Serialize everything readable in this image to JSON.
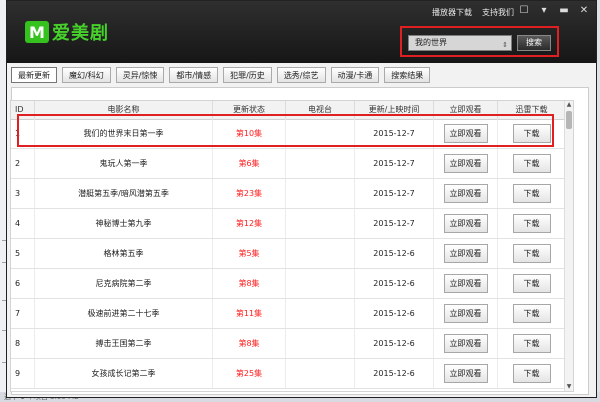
{
  "app": {
    "logo_mark": "M",
    "logo_text": "爱美剧"
  },
  "top": {
    "links": [
      "播放器下载",
      "支持我们"
    ]
  },
  "window_icons": {
    "message": "☐",
    "menu": "▾",
    "minimize": "▬",
    "close": "✕"
  },
  "search": {
    "value": "我的世界",
    "scroll_glyph": "⇕",
    "button_label": "搜索"
  },
  "tabs": [
    "最新更新",
    "魔幻/科幻",
    "灵异/惊悚",
    "都市/情感",
    "犯罪/历史",
    "选秀/综艺",
    "动漫/卡通",
    "搜索结果"
  ],
  "active_tab": "最新更新",
  "table": {
    "headers": [
      "ID",
      "电影名称",
      "更新状态",
      "电视台",
      "更新/上映时间",
      "立即观看",
      "迅雷下载"
    ],
    "rows": [
      {
        "id": "1",
        "name": "我们的世界末日第一季",
        "status": "第10集",
        "tv": "",
        "date": "2015-12-7",
        "watch": "立即观看",
        "download": "下载"
      },
      {
        "id": "2",
        "name": "鬼玩人第一季",
        "status": "第6集",
        "tv": "",
        "date": "2015-12-7",
        "watch": "立即观看",
        "download": "下载"
      },
      {
        "id": "3",
        "name": "潜艇第五季/暗风潜第五季",
        "status": "第23集",
        "tv": "",
        "date": "2015-12-7",
        "watch": "立即观看",
        "download": "下载"
      },
      {
        "id": "4",
        "name": "神秘博士第九季",
        "status": "第12集",
        "tv": "",
        "date": "2015-12-7",
        "watch": "立即观看",
        "download": "下载"
      },
      {
        "id": "5",
        "name": "格林第五季",
        "status": "第5集",
        "tv": "",
        "date": "2015-12-6",
        "watch": "立即观看",
        "download": "下载"
      },
      {
        "id": "6",
        "name": "尼克病院第二季",
        "status": "第8集",
        "tv": "",
        "date": "2015-12-6",
        "watch": "立即观看",
        "download": "下载"
      },
      {
        "id": "7",
        "name": "极速前进第二十七季",
        "status": "第11集",
        "tv": "",
        "date": "2015-12-6",
        "watch": "立即观看",
        "download": "下载"
      },
      {
        "id": "8",
        "name": "搏击王国第二季",
        "status": "第8集",
        "tv": "",
        "date": "2015-12-6",
        "watch": "立即观看",
        "download": "下载"
      },
      {
        "id": "9",
        "name": "女孩成长记第二季",
        "status": "第25集",
        "tv": "",
        "date": "2015-12-6",
        "watch": "立即观看",
        "download": "下载"
      }
    ]
  },
  "scrollbar": {
    "up": "▲",
    "down": "▼"
  },
  "statusbar": {
    "text": "选中 1 个项目 3.60 MB"
  },
  "colors": {
    "brand_green": "#35c21f",
    "status_red": "#ff1d1d",
    "highlight_red": "#e02020"
  }
}
